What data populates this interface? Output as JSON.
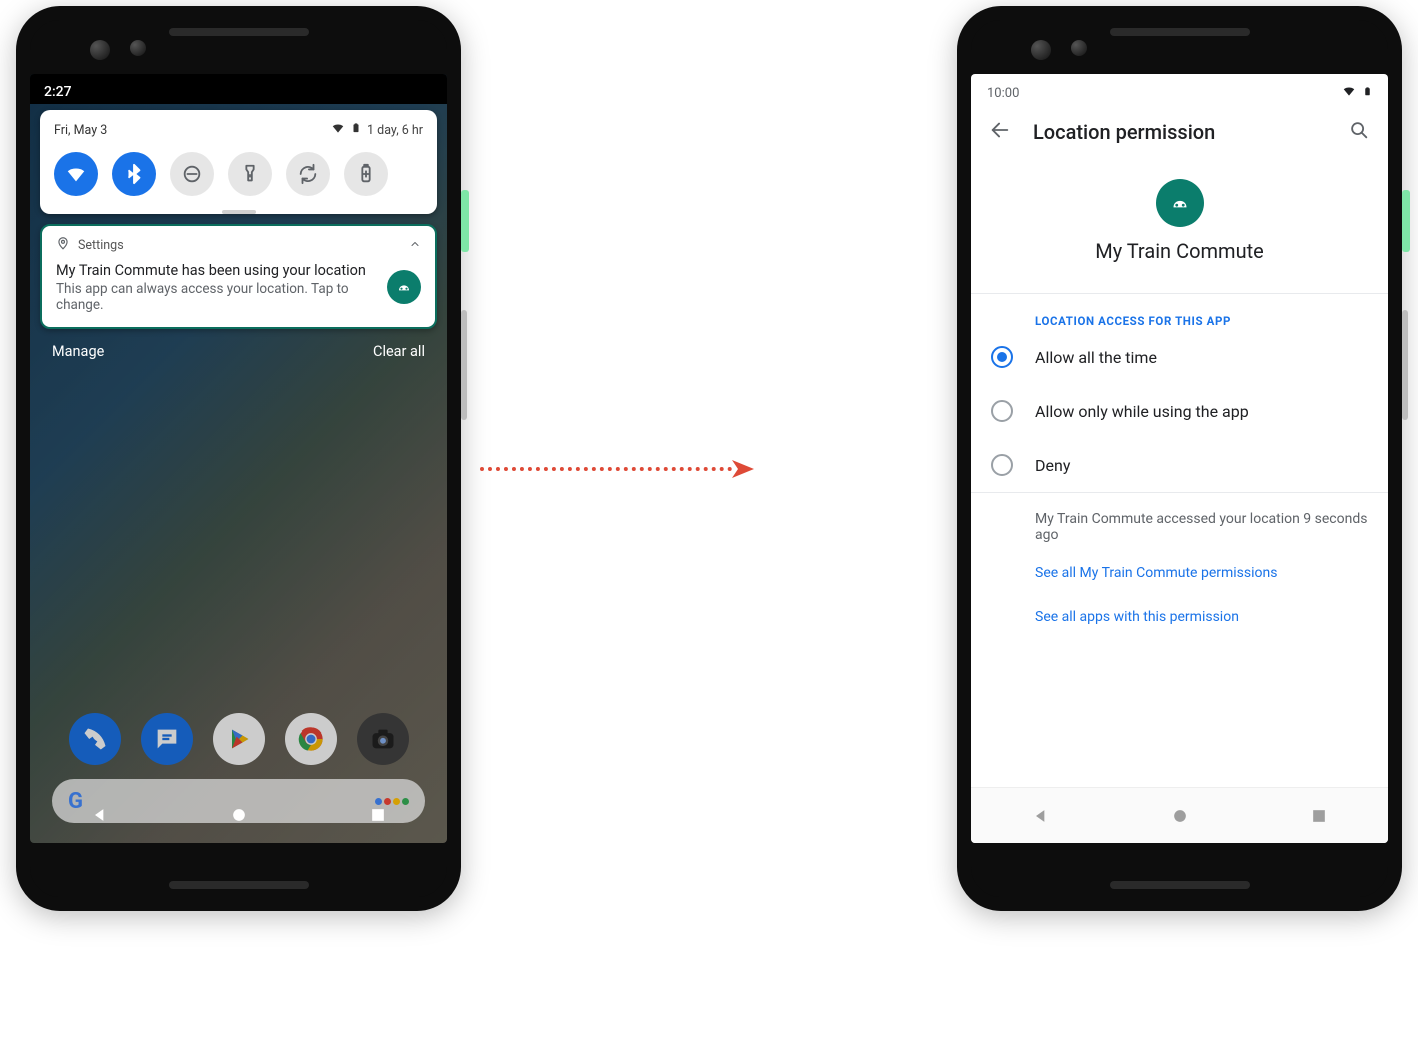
{
  "left": {
    "status_time": "2:27",
    "qs_date": "Fri, May 3",
    "qs_battery_text": "1 day, 6 hr",
    "tiles": {
      "wifi": "wifi-icon",
      "bluetooth": "bluetooth-icon",
      "dnd": "do-not-disturb-icon",
      "flashlight": "flashlight-icon",
      "rotate": "auto-rotate-icon",
      "battery": "battery-saver-icon"
    },
    "notif_source": "Settings",
    "notif_title": "My Train Commute has been using your location",
    "notif_body": "This app can always access your location. Tap to change.",
    "manage": "Manage",
    "clear": "Clear all",
    "dock_apps": [
      "phone",
      "messages",
      "play-store",
      "chrome",
      "camera"
    ]
  },
  "right": {
    "status_time": "10:00",
    "title": "Location permission",
    "app_name": "My Train Commute",
    "section_label": "LOCATION ACCESS FOR THIS APP",
    "opt_all": "Allow all the time",
    "opt_fore": "Allow only while using the app",
    "opt_deny": "Deny",
    "selected": "all",
    "usage_info": "My Train Commute accessed your location 9 seconds ago",
    "link_app_perms": "See all My Train Commute permissions",
    "link_apps_perm": "See all apps with this permission"
  }
}
